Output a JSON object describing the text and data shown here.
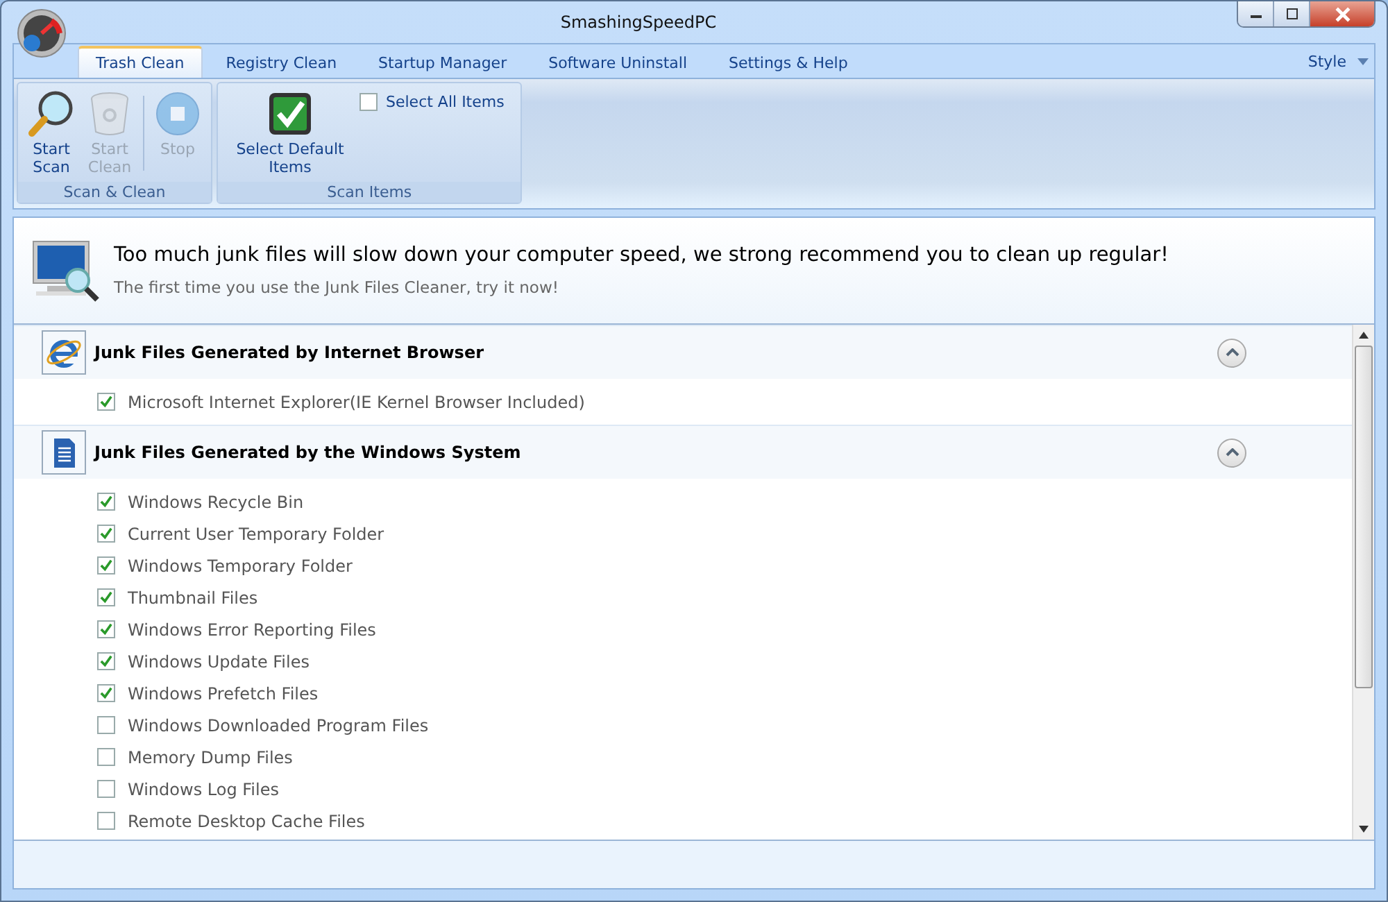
{
  "window": {
    "title": "SmashingSpeedPC"
  },
  "tabs": [
    {
      "label": "Trash Clean",
      "selected": true
    },
    {
      "label": "Registry Clean",
      "selected": false
    },
    {
      "label": "Startup Manager",
      "selected": false
    },
    {
      "label": "Software Uninstall",
      "selected": false
    },
    {
      "label": "Settings & Help",
      "selected": false
    }
  ],
  "style_menu": {
    "label": "Style"
  },
  "ribbon_groups": [
    {
      "label": "Scan & Clean",
      "buttons": [
        {
          "label": "Start Scan",
          "kind": "search",
          "disabled": false
        },
        {
          "label": "Start Clean",
          "kind": "recycle",
          "disabled": true
        },
        {
          "label": "Stop",
          "kind": "stop",
          "disabled": true
        }
      ]
    },
    {
      "label": "Scan Items",
      "buttons": [
        {
          "label": "Select Default Items",
          "kind": "check",
          "disabled": false
        }
      ],
      "checkbox": {
        "label": "Select All Items",
        "checked": false
      }
    }
  ],
  "banner": {
    "headline": "Too much junk files will slow down your computer speed, we strong recommend you to clean up regular!",
    "subtext": "The first time you use the Junk Files Cleaner, try it now!"
  },
  "sections": [
    {
      "title": "Junk Files Generated by Internet Browser",
      "kind": "browser",
      "expanded": true,
      "items": [
        {
          "label": "Microsoft Internet Explorer(IE Kernel Browser Included)",
          "checked": true
        }
      ]
    },
    {
      "title": "Junk Files Generated by the Windows System",
      "kind": "document",
      "expanded": true,
      "items": [
        {
          "label": "Windows Recycle Bin",
          "checked": true
        },
        {
          "label": "Current User Temporary Folder",
          "checked": true
        },
        {
          "label": "Windows Temporary Folder",
          "checked": true
        },
        {
          "label": "Thumbnail Files",
          "checked": true
        },
        {
          "label": "Windows Error Reporting Files",
          "checked": true
        },
        {
          "label": "Windows Update Files",
          "checked": true
        },
        {
          "label": "Windows Prefetch Files",
          "checked": true
        },
        {
          "label": "Windows Downloaded Program Files",
          "checked": false
        },
        {
          "label": "Memory Dump Files",
          "checked": false
        },
        {
          "label": "Windows Log Files",
          "checked": false
        },
        {
          "label": "Remote Desktop Cache Files",
          "checked": false
        }
      ]
    }
  ]
}
